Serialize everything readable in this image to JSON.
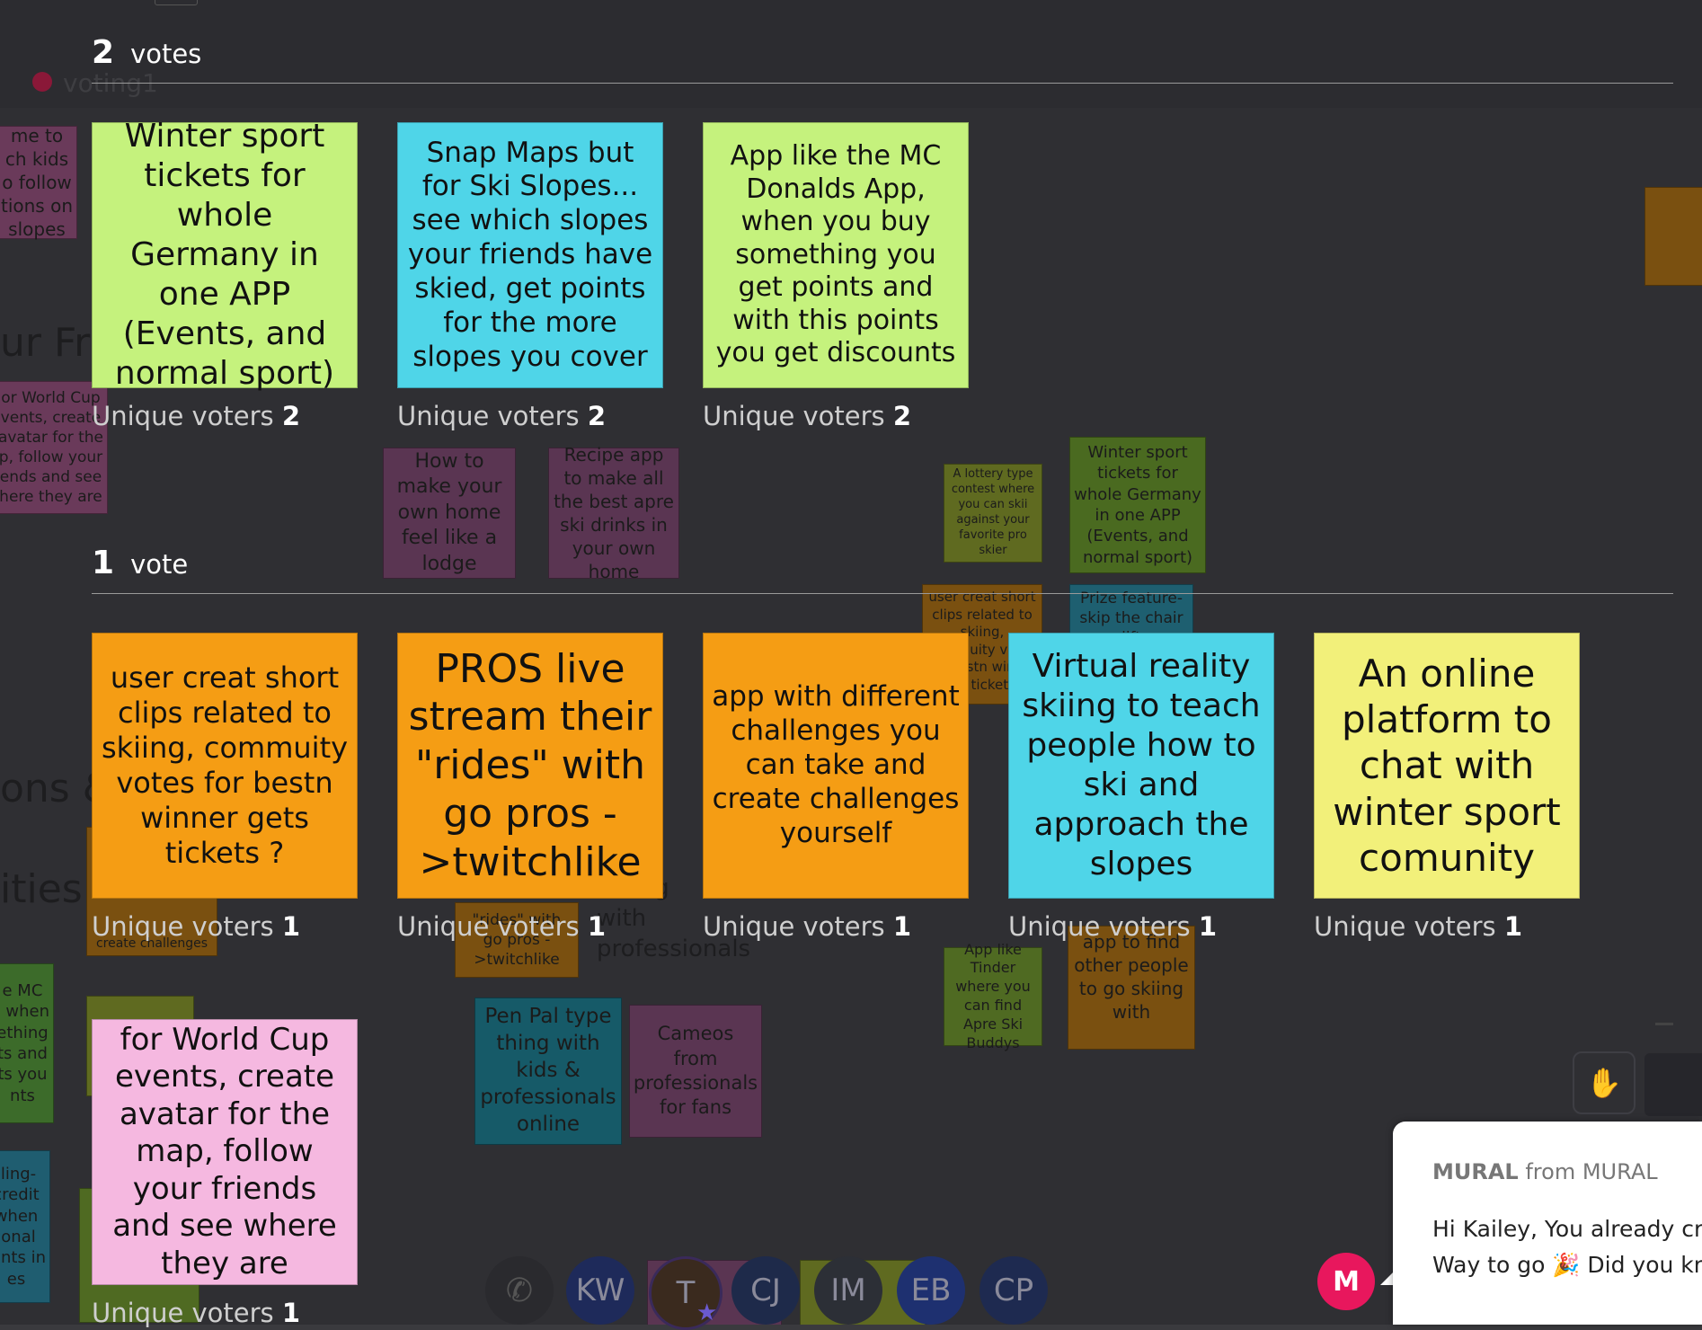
{
  "background": {
    "section_label": "voting1",
    "section_titles": [
      "ur Frie",
      "ons &",
      "ities"
    ],
    "fragments": {
      "note_top_left": "me to\nch kids\no follow\ntions on\nslopes",
      "note_world_cup": "or World Cup\nvents, create\navatar for the\np, follow your\nends and see\nhere they are",
      "note_mc": "e MC\n, when\nething\nts and\nts you\nnts",
      "note_credit": "iling-\ncredit\nwhen\nional\noints in\nes",
      "create_challenges": "create challenges",
      "rides_fragment": "\"rides\" with\ngo pros -\n>twitchlike",
      "connecting": "ecting\nwith\nprofessionals"
    },
    "notes": [
      {
        "text": "How to make your own home feel like a lodge"
      },
      {
        "text": "Recipe app to make all the best apre ski drinks in your own home"
      },
      {
        "text": "A lottery type contest where you can skii against your favorite pro skier"
      },
      {
        "text": "Winter sport tickets for whole Germany in one APP (Events, and normal sport)"
      },
      {
        "text": "user creat short clips related to skiing, commuity votes for bestn winner gets tickets ?"
      },
      {
        "text": "Prize feature- skip the chair lift"
      },
      {
        "text": "App like Tinder where you can find Apre Ski Buddys"
      },
      {
        "text": "app to find other people to go skiing with"
      },
      {
        "text": "Pen Pal type thing with kids & professionals online"
      },
      {
        "text": "Cameos from professionals for fans"
      }
    ]
  },
  "voting": {
    "groups": [
      {
        "count": "2",
        "label": "votes"
      },
      {
        "count": "1",
        "label": "vote"
      }
    ],
    "voters_label": "Unique voters",
    "cards": [
      {
        "text": "Winter sport tickets for whole Germany in one APP (Events, and normal sport)",
        "voters": "2",
        "color": "#c5f27d"
      },
      {
        "text": "Snap Maps but for Ski Slopes... see which slopes your friends have skied, get points for the more slopes you cover",
        "voters": "2",
        "color": "#4fd5e8"
      },
      {
        "text": "App like the MC Donalds App, when you buy something you get points and with this points you get discounts",
        "voters": "2",
        "color": "#c5f27d"
      },
      {
        "text": "user creat short clips related to skiing, commuity votes for bestn winner gets tickets ?",
        "voters": "1",
        "color": "#f59d14"
      },
      {
        "text": "PROS live stream their \"rides\" with go pros ->twitchlike",
        "voters": "1",
        "color": "#f59d14"
      },
      {
        "text": "app with different challenges you can take and create challenges yourself",
        "voters": "1",
        "color": "#f59d14"
      },
      {
        "text": "Virtual reality skiing to teach people how to ski and approach the slopes",
        "voters": "1",
        "color": "#4fd5e8"
      },
      {
        "text": "An online platform to chat with winter sport comunity",
        "voters": "1",
        "color": "#f2f07a"
      },
      {
        "text": "for World Cup events, create avatar for the map, follow your friends and see where they are",
        "voters": "1",
        "color": "#f5b8e0"
      }
    ]
  },
  "collaborators": [
    "KW",
    "T",
    "CJ",
    "IM",
    "EB",
    "CP"
  ],
  "chat": {
    "sender": "MURAL",
    "from_text": "from MURAL",
    "line1": "Hi Kailey, You already cre",
    "line2": "Way to go 🎉 Did you kn",
    "badge": "M"
  },
  "colors": {
    "accent": "#e8175d",
    "overlay": "#2f2f33"
  }
}
